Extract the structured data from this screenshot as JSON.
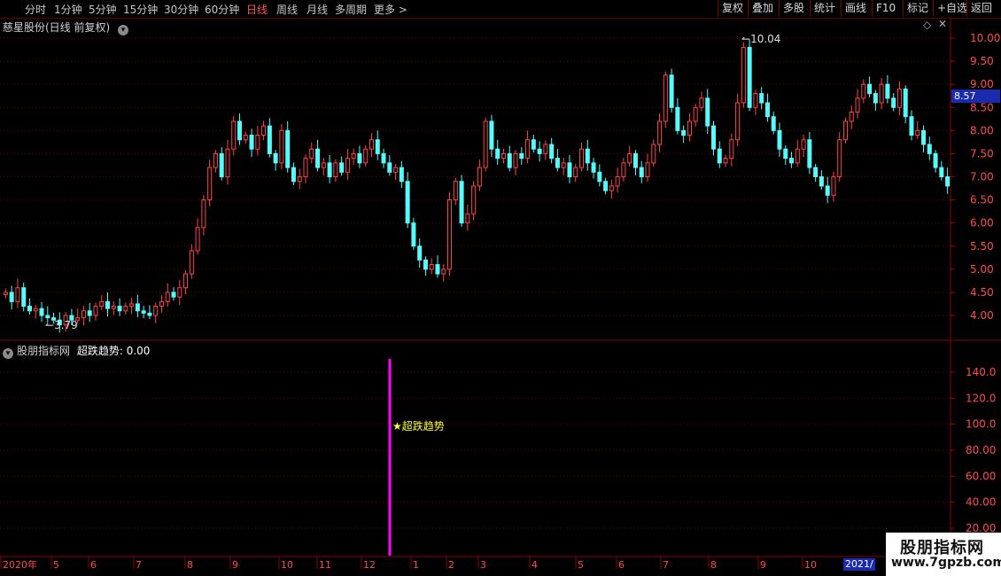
{
  "toolbar": {
    "periods": [
      "分时",
      "1分钟",
      "5分钟",
      "15分钟",
      "30分钟",
      "60分钟",
      "日线",
      "周线",
      "月线",
      "多周期",
      "更多"
    ],
    "active_period": "日线",
    "right_buttons": [
      "复权",
      "叠加",
      "多股",
      "统计",
      "画线",
      "F10",
      "标记",
      "+自选",
      "返回"
    ]
  },
  "main_panel": {
    "title": "慈星股份(日线 前复权)",
    "current_price": "8.57",
    "high_label": "10.04",
    "low_label": "3.79",
    "y_ticks": [
      "10.00",
      "9.50",
      "9.00",
      "8.50",
      "8.00",
      "7.50",
      "7.00",
      "6.50",
      "6.00",
      "5.50",
      "5.00",
      "4.50",
      "4.00"
    ]
  },
  "indicator_panel": {
    "source_label": "股朋指标网",
    "indicator_name": "超跌趋势",
    "indicator_value": "0.00",
    "signal_label": "★超跌趋势",
    "y_ticks": [
      "140.0",
      "120.0",
      "100.0",
      "80.00",
      "60.00",
      "40.00",
      "20.00"
    ]
  },
  "time_axis": {
    "labels": [
      "2020年",
      "5",
      "6",
      "7",
      "8",
      "9",
      "10",
      "11",
      "12",
      "1",
      "2",
      "3",
      "4",
      "5",
      "6",
      "7",
      "8",
      "9",
      "10",
      "2021/"
    ]
  },
  "watermark": {
    "line1": "股朋指标网",
    "line2": "www.7gpzb.com"
  },
  "colors": {
    "up": "#ff4444",
    "down": "#54fcfc",
    "grid": "#7a0000",
    "signal": "#ff00ff",
    "label_yellow": "#ffff33",
    "accent_blue": "#1a2bb0"
  },
  "chart_data": {
    "type": "candlestick",
    "ylim": [
      3.5,
      10.3
    ],
    "close_series": [
      4.5,
      4.3,
      4.6,
      4.2,
      4.1,
      4.15,
      4.0,
      3.95,
      3.9,
      3.8,
      4.0,
      3.9,
      3.95,
      4.1,
      4.0,
      4.2,
      4.3,
      4.15,
      4.2,
      4.1,
      4.2,
      4.25,
      4.1,
      4.05,
      4.0,
      4.2,
      4.3,
      4.5,
      4.4,
      4.6,
      4.9,
      5.4,
      5.9,
      6.5,
      7.2,
      7.5,
      7.0,
      7.6,
      8.2,
      7.8,
      7.9,
      7.6,
      7.9,
      8.1,
      7.5,
      7.3,
      8.0,
      7.2,
      6.9,
      7.0,
      7.4,
      7.6,
      7.2,
      7.3,
      7.0,
      7.3,
      7.1,
      7.4,
      7.5,
      7.3,
      7.6,
      7.8,
      7.5,
      7.3,
      7.1,
      7.2,
      6.9,
      6.0,
      5.5,
      5.2,
      5.0,
      5.1,
      4.9,
      5.0,
      6.5,
      6.9,
      6.0,
      6.2,
      6.8,
      7.2,
      8.2,
      7.6,
      7.4,
      7.5,
      7.2,
      7.5,
      7.4,
      7.8,
      7.6,
      7.5,
      7.7,
      7.4,
      7.2,
      7.3,
      7.0,
      7.2,
      7.6,
      7.3,
      7.1,
      6.9,
      6.7,
      6.8,
      7.0,
      7.3,
      7.5,
      7.2,
      7.0,
      7.3,
      7.7,
      8.2,
      9.2,
      8.5,
      8.0,
      7.9,
      8.2,
      8.5,
      8.7,
      8.1,
      7.6,
      7.3,
      7.4,
      7.8,
      8.6,
      9.8,
      8.5,
      8.8,
      8.6,
      8.3,
      8.0,
      7.6,
      7.4,
      7.3,
      7.6,
      7.8,
      7.2,
      7.0,
      6.8,
      6.6,
      7.0,
      7.8,
      8.2,
      8.4,
      8.7,
      9.0,
      8.8,
      8.6,
      9.0,
      8.7,
      8.5,
      8.9,
      8.3,
      7.9,
      8.0,
      7.7,
      7.5,
      7.2,
      7.0,
      6.8
    ],
    "high": 10.04,
    "low": 3.79,
    "last": 8.57,
    "indicator": {
      "name": "超跌趋势",
      "ylim": [
        0,
        150
      ],
      "signal_value": 150
    }
  }
}
